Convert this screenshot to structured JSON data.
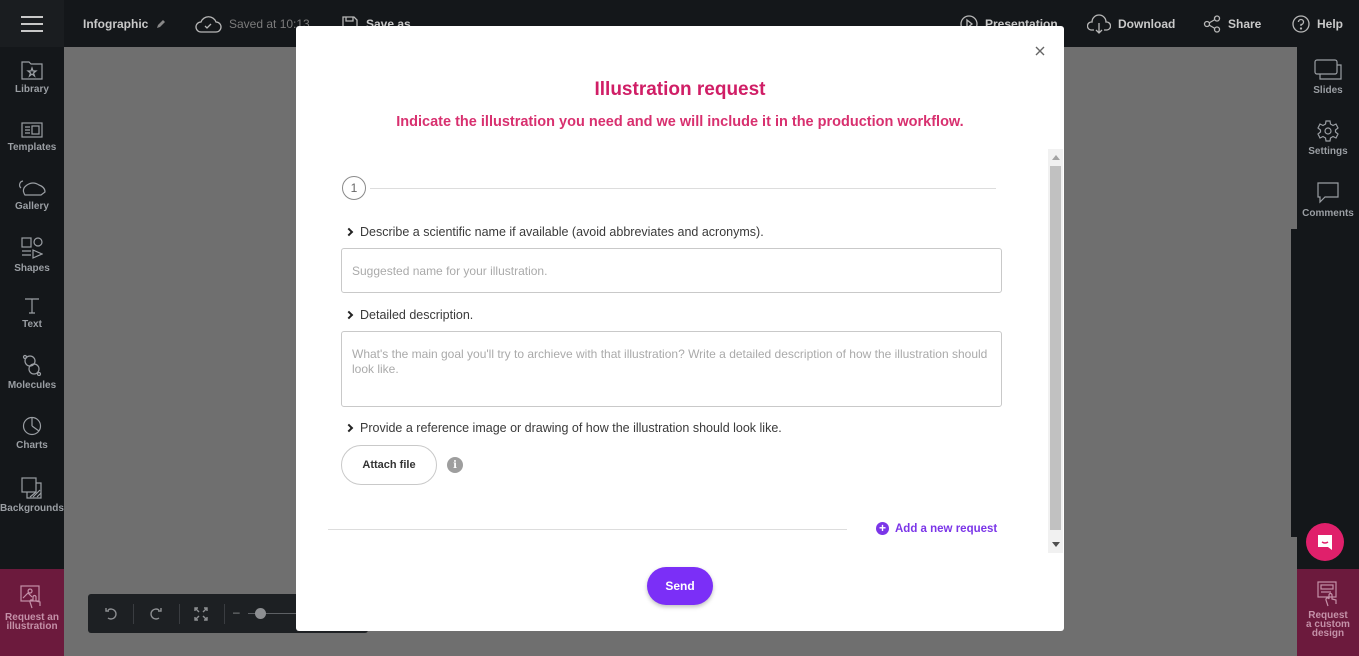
{
  "topbar": {
    "menu_icon": "hamburger-menu-icon",
    "document_title": "Infographic",
    "edit_icon": "pencil-icon",
    "save_status": "Saved at 10:13",
    "save_as": "Save as",
    "presentation": "Presentation",
    "download": "Download",
    "share": "Share",
    "help": "Help"
  },
  "left_sidebar": {
    "items": [
      {
        "label": "Library",
        "icon": "folder-star-icon"
      },
      {
        "label": "Templates",
        "icon": "template-icon"
      },
      {
        "label": "Gallery",
        "icon": "mouse-animal-icon"
      },
      {
        "label": "Shapes",
        "icon": "shapes-icon"
      },
      {
        "label": "Text",
        "icon": "text-icon"
      },
      {
        "label": "Molecules",
        "icon": "molecule-icon"
      },
      {
        "label": "Charts",
        "icon": "pie-chart-icon"
      },
      {
        "label": "Backgrounds",
        "icon": "background-icon"
      }
    ],
    "request_illustration": {
      "line1": "Request an",
      "line2": "illustration",
      "icon": "image-request-icon"
    }
  },
  "right_sidebar": {
    "items": [
      {
        "label": "Slides",
        "icon": "slides-icon"
      },
      {
        "label": "Settings",
        "icon": "gear-icon"
      },
      {
        "label": "Comments",
        "icon": "comment-icon"
      }
    ],
    "request_custom_design": {
      "line1": "Request",
      "line2": "a custom",
      "line3": "design",
      "icon": "design-request-icon"
    }
  },
  "bottom_toolbar": {
    "undo_icon": "undo-icon",
    "redo_icon": "redo-icon",
    "fit_icon": "fit-screen-icon",
    "zoom_out": "–",
    "zoom_level_fraction": 0.1
  },
  "modal": {
    "title": "Illustration request",
    "subtitle": "Indicate the illustration you need and we will include it in the production workflow.",
    "step_number": "1",
    "question_name": "Describe a scientific name if available (avoid abbreviates and acronyms).",
    "name_placeholder": "Suggested name for your illustration.",
    "name_value": "",
    "question_description": "Detailed description.",
    "description_placeholder": "What's the main goal you'll try to archieve with that illustration? Write a detailed description of how the illustration should look like.",
    "description_value": "",
    "question_reference": "Provide a reference image or drawing of how the illustration should look like.",
    "attach_file": "Attach file",
    "info_glyph": "i",
    "add_request": "Add a new request",
    "add_glyph": "+",
    "send": "Send"
  },
  "colors": {
    "title_pink": "#d01e66",
    "accent_purple": "#7b2ff7",
    "request_panel": "#6c1a3d",
    "chat_bubble": "#e0206b"
  }
}
